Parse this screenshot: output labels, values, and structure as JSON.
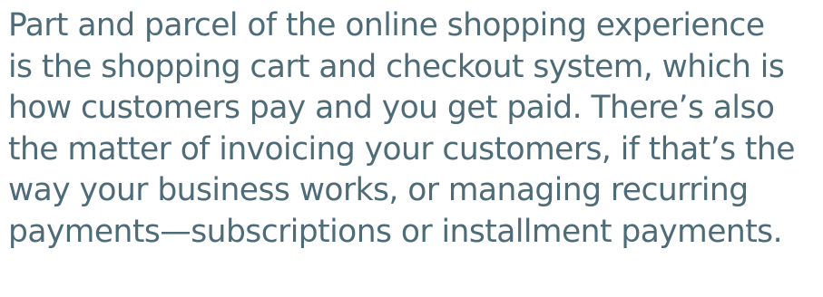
{
  "paragraph": {
    "lines": [
      "Part and parcel of the online shopping experience",
      "is the shopping cart and checkout system, which is",
      "how customers pay and you get paid. There’s also",
      "the matter of invoicing your customers, if that’s the",
      "way your business works, or managing recurring",
      "payments—subscriptions or installment payments."
    ]
  },
  "colors": {
    "text": "#4e6b78",
    "background": "#ffffff"
  }
}
